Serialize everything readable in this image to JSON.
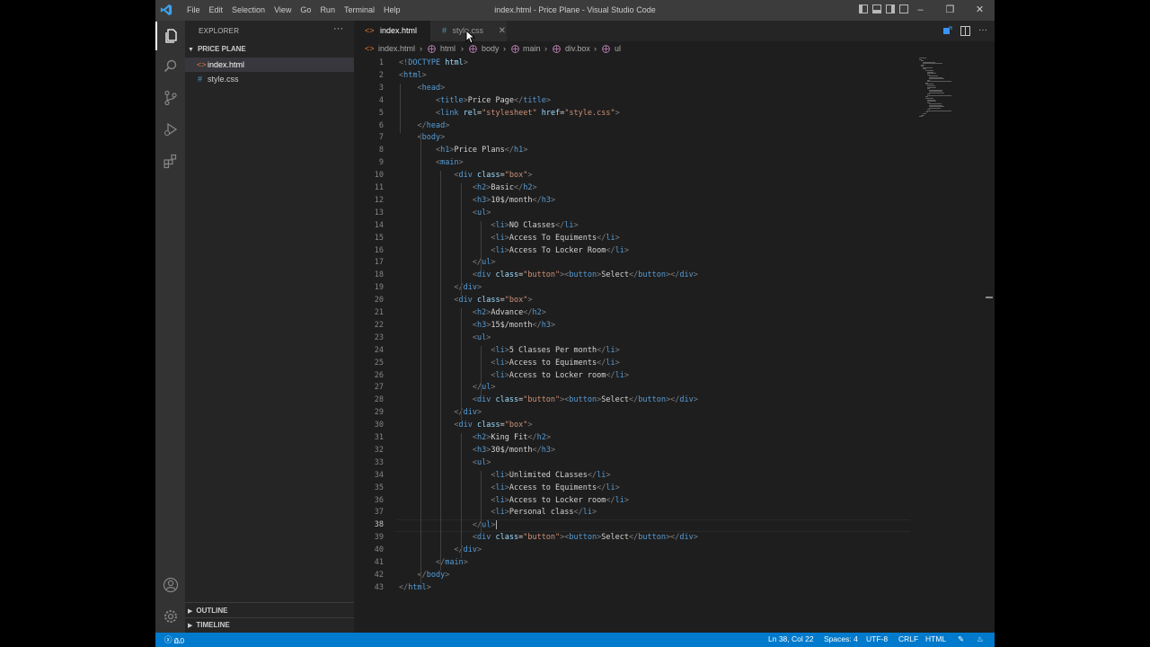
{
  "window": {
    "title": "index.html - Price Plane - Visual Studio Code",
    "menu": [
      "File",
      "Edit",
      "Selection",
      "View",
      "Go",
      "Run",
      "Terminal",
      "Help"
    ]
  },
  "sidebar": {
    "header": "EXPLORER",
    "folder": "PRICE PLANE",
    "files": [
      {
        "name": "index.html",
        "icon": "<>",
        "selected": true
      },
      {
        "name": "style.css",
        "icon": "#",
        "selected": false
      }
    ],
    "sections": [
      "OUTLINE",
      "TIMELINE"
    ]
  },
  "tabs": [
    {
      "label": "index.html",
      "icon": "<>",
      "active": true,
      "close": "✕"
    },
    {
      "label": "style.css",
      "icon": "#",
      "active": false,
      "close": "✕"
    }
  ],
  "breadcrumb": [
    "index.html",
    "html",
    "body",
    "main",
    "div.box",
    "ul"
  ],
  "editor": {
    "current_line": 38,
    "line_numbers": [
      "1",
      "2",
      "3",
      "4",
      "5",
      "6",
      "7",
      "8",
      "9",
      "10",
      "11",
      "12",
      "13",
      "14",
      "15",
      "16",
      "17",
      "18",
      "19",
      "20",
      "21",
      "22",
      "23",
      "24",
      "25",
      "26",
      "27",
      "28",
      "29",
      "30",
      "31",
      "32",
      "33",
      "34",
      "35",
      "36",
      "37",
      "38",
      "39",
      "40",
      "41",
      "42",
      "43"
    ],
    "lines": [
      "<!DOCTYPE html>",
      "<html>",
      "    <head>",
      "        <title>Price Page</title>",
      "        <link rel=\"stylesheet\" href=\"style.css\">",
      "    </head>",
      "    <body>",
      "        <h1>Price Plans</h1>",
      "        <main>",
      "            <div class=\"box\">",
      "                <h2>Basic</h2>",
      "                <h3>10$/month</h3>",
      "                <ul>",
      "                    <li>NO Classes</li>",
      "                    <li>Access To Equiments</li>",
      "                    <li>Access To Locker Room</li>",
      "                </ul>",
      "                <div class=\"button\"><button>Select</button></div>",
      "            </div>",
      "            <div class=\"box\">",
      "                <h2>Advance</h2>",
      "                <h3>15$/month</h3>",
      "                <ul>",
      "                    <li>5 Classes Per month</li>",
      "                    <li>Access to Equiments</li>",
      "                    <li>Access to Locker room</li>",
      "                </ul>",
      "                <div class=\"button\"><button>Select</button></div>",
      "            </div>",
      "            <div class=\"box\">",
      "                <h2>King Fit</h2>",
      "                <h3>30$/month</h3>",
      "                <ul>",
      "                    <li>Unlimited CLasses</li>",
      "                    <li>Access to Equiments</li>",
      "                    <li>Access to Locker room</li>",
      "                    <li>Personal class</li>",
      "                </ul>",
      "                <div class=\"button\"><button>Select</button></div>",
      "            </div>",
      "        </main>",
      "    </body>",
      "</html>"
    ]
  },
  "status": {
    "errors": "0",
    "warnings": "0",
    "position": "Ln 38, Col 22",
    "spaces": "Spaces: 4",
    "encoding": "UTF-8",
    "eol": "CRLF",
    "language": "HTML"
  },
  "colors": {
    "accent": "#007acc",
    "editor_bg": "#1e1e1e",
    "sidebar_bg": "#252526",
    "tag": "#569cd6",
    "attribute": "#9cdcfe",
    "string": "#ce9178"
  }
}
